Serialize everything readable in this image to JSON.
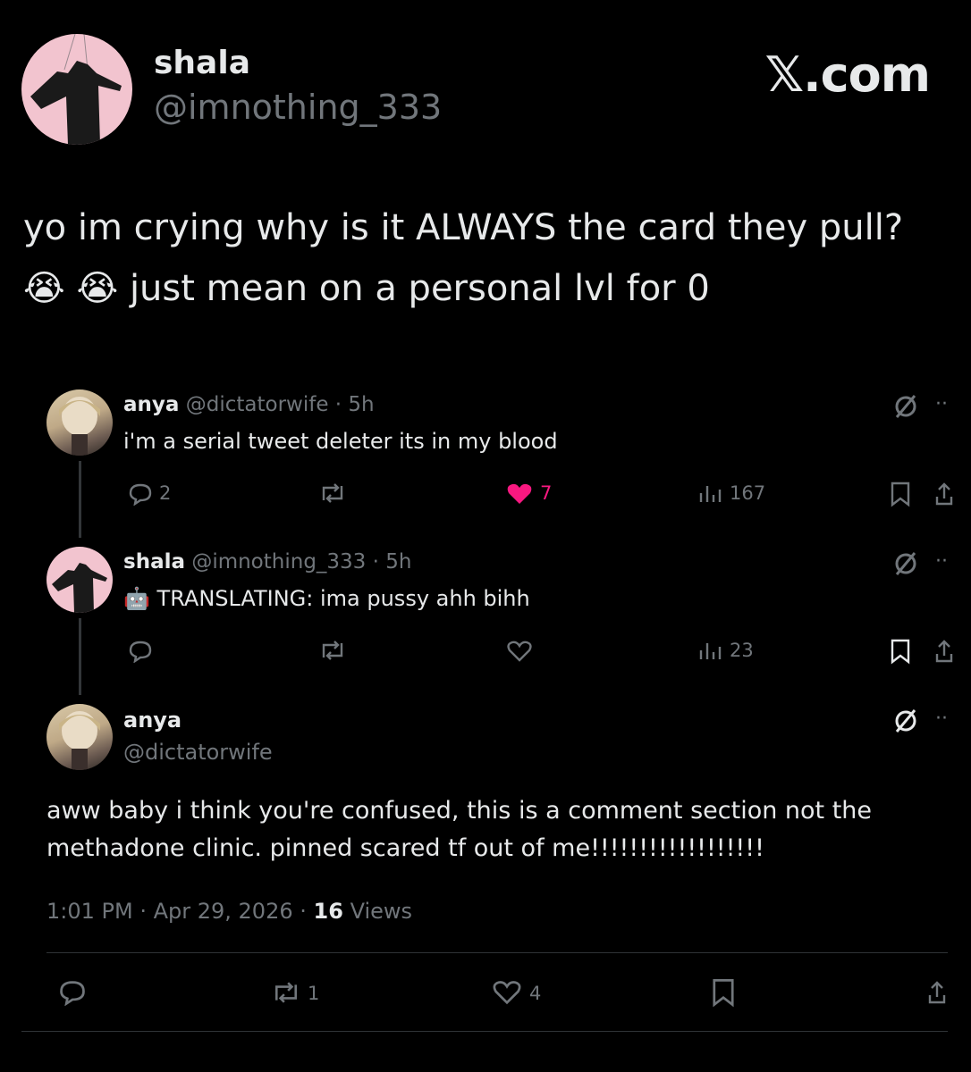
{
  "header": {
    "name": "shala",
    "handle": "@imnothing_333",
    "brand": "𝕏.com"
  },
  "main_post": {
    "line1": "yo im crying why is it ALWAYS the card they pull?",
    "emoji": "😭",
    "line2": "just mean on a personal lvl for 0"
  },
  "replies": [
    {
      "name": "anya",
      "handle": "@dictatorwife",
      "time": "· 5h",
      "text": "i'm a serial tweet deleter its in my blood",
      "replies": "2",
      "likes": "7",
      "views": "167"
    },
    {
      "name": "shala",
      "handle": "@imnothing_333",
      "time": "· 5h",
      "emoji": "🤖",
      "text": "TRANSLATING: ima pussy ahh bihh",
      "views": "23"
    }
  ],
  "focused": {
    "name": "anya",
    "handle": "@dictatorwife",
    "line1": "aww baby i think you're confused, this is a comment section not the",
    "line2": "methadone clinic. pinned scared tf out of me!!!!!!!!!!!!!!!!!!",
    "time": "1:01 PM · Apr 29, 2026 ·",
    "views_count": "16",
    "views_label": "Views",
    "retweets": "1",
    "likes": "4"
  },
  "colors": {
    "like_active": "#f91880",
    "muted": "#71767b",
    "avatar_pink": "#f2c4cf"
  }
}
